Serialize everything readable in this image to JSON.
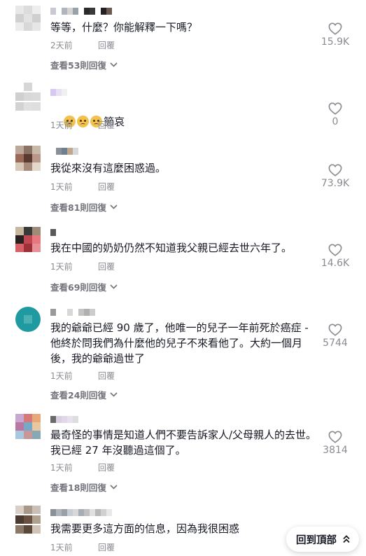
{
  "back_to_top": {
    "label": "回到頂部"
  },
  "comments": [
    {
      "text": "等等，什麼？你能解釋一下嗎？",
      "time": "2天前",
      "reply": "回覆",
      "likes": "15.9K",
      "view_replies": "查看53則回復"
    },
    {
      "text": "節哀",
      "time": "1天前",
      "reply": "回覆",
      "likes": "0",
      "emoji_count": 3
    },
    {
      "text": "我從來沒有這麼困惑過。",
      "time": "1天前",
      "reply": "回覆",
      "likes": "73.9K",
      "view_replies": "查看81則回復"
    },
    {
      "text": "我在中國的奶奶仍然不知道我父親已經去世六年了。",
      "time": "1天前",
      "reply": "回覆",
      "likes": "14.6K",
      "view_replies": "查看69則回復"
    },
    {
      "text": "我的爺爺已經 90 歲了，他唯一的兒子一年前死於癌症 - 他終於問我們為什麼他的兒子不來看他了。大約一個月後，我的爺爺過世了",
      "time": "1天前",
      "reply": "回覆",
      "likes": "5744",
      "view_replies": "查看24則回復"
    },
    {
      "text": "最奇怪的事情是知道人們不要告訴家人/父母親人的去世。我已經 27 年沒聽過這個了。",
      "time": "1天前",
      "reply": "回覆",
      "likes": "3814",
      "view_replies": "查看18則回復"
    },
    {
      "text": "我需要更多這方面的信息，因為我很困惑",
      "time": "1天前",
      "reply": "回覆"
    }
  ]
}
